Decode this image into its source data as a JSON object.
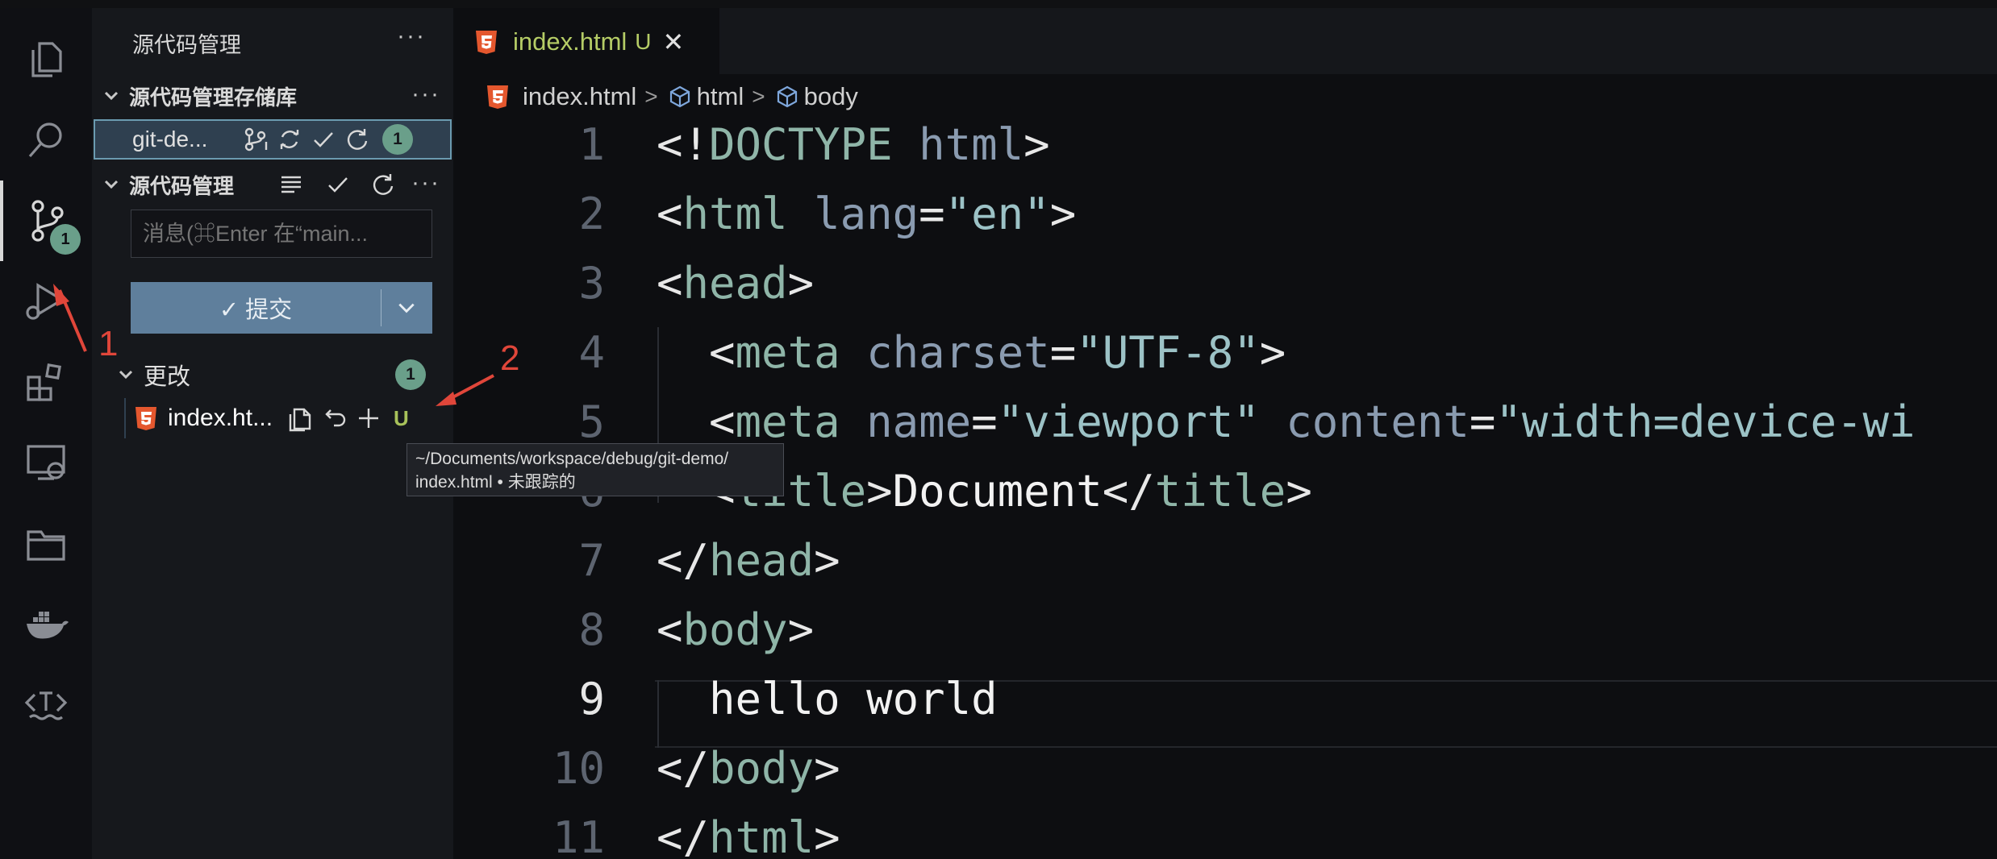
{
  "activity_bar": {
    "source_control_badge": "1"
  },
  "sidebar": {
    "title": "源代码管理",
    "more": "···",
    "repositories_section": {
      "label": "源代码管理存储库",
      "more": "···"
    },
    "repo": {
      "name": "git-de...",
      "badge": "1"
    },
    "scm_section": {
      "label": "源代码管理",
      "more": "···"
    },
    "message_placeholder": "消息(⌘Enter 在“main...",
    "commit_button": "✓ 提交",
    "changes": {
      "label": "更改",
      "badge": "1"
    },
    "file": {
      "name": "index.ht...",
      "status": "U"
    }
  },
  "tooltip": {
    "line1": "~/Documents/workspace/debug/git-demo/",
    "line2": "index.html • 未跟踪的"
  },
  "annotations": {
    "one": "1",
    "two": "2"
  },
  "editor": {
    "tab": {
      "title": "index.html",
      "status": "U",
      "close": "✕"
    },
    "breadcrumb": {
      "file": "index.html",
      "node1": "html",
      "node2": "body",
      "sep": ">"
    },
    "line_numbers": [
      "1",
      "2",
      "3",
      "4",
      "5",
      "6",
      "7",
      "8",
      "9",
      "10",
      "11"
    ],
    "current_line": 9
  },
  "code": {
    "l1": {
      "open": "<!",
      "kw": "DOCTYPE",
      "sp": " ",
      "attr": "html",
      "close": ">"
    },
    "l2": {
      "open": "<",
      "tag": "html",
      "sp": " ",
      "attr": "lang",
      "eq": "=",
      "str": "\"en\"",
      "close": ">"
    },
    "l3": {
      "open": "<",
      "tag": "head",
      "close": ">"
    },
    "l4": {
      "open": "  <",
      "tag": "meta",
      "sp": " ",
      "attr": "charset",
      "eq": "=",
      "str": "\"UTF-8\"",
      "close": ">"
    },
    "l5": {
      "open": "  <",
      "tag": "meta",
      "sp": " ",
      "attr1": "name",
      "eq1": "=",
      "str1": "\"viewport\"",
      "sp2": " ",
      "attr2": "content",
      "eq2": "=",
      "str2": "\"width=device-wi"
    },
    "l6": {
      "open": "  <",
      "tag": "title",
      "close1": ">",
      "text": "Document",
      "open2": "</",
      "tag2": "title",
      "close2": ">"
    },
    "l7": {
      "open": "</",
      "tag": "head",
      "close": ">"
    },
    "l8": {
      "open": "<",
      "tag": "body",
      "close": ">"
    },
    "l9": {
      "text": "  hello world"
    },
    "l10": {
      "open": "</",
      "tag": "body",
      "close": ">"
    },
    "l11": {
      "open": "</",
      "tag": "html",
      "close": ">"
    }
  }
}
